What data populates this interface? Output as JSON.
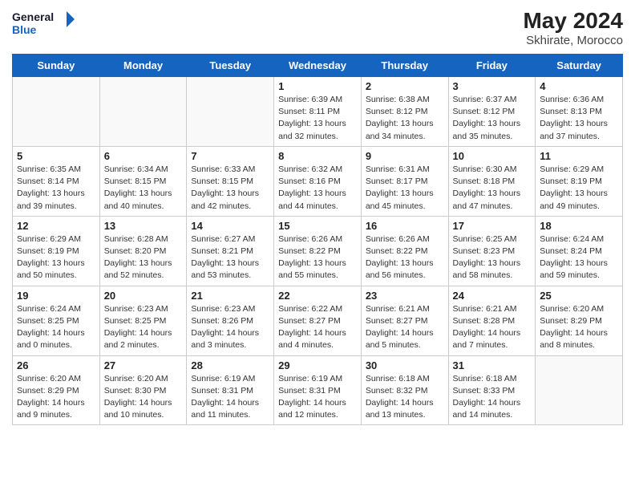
{
  "header": {
    "logo_line1": "General",
    "logo_line2": "Blue",
    "month_year": "May 2024",
    "location": "Skhirate, Morocco"
  },
  "days_of_week": [
    "Sunday",
    "Monday",
    "Tuesday",
    "Wednesday",
    "Thursday",
    "Friday",
    "Saturday"
  ],
  "weeks": [
    [
      {
        "num": "",
        "info": ""
      },
      {
        "num": "",
        "info": ""
      },
      {
        "num": "",
        "info": ""
      },
      {
        "num": "1",
        "info": "Sunrise: 6:39 AM\nSunset: 8:11 PM\nDaylight: 13 hours\nand 32 minutes."
      },
      {
        "num": "2",
        "info": "Sunrise: 6:38 AM\nSunset: 8:12 PM\nDaylight: 13 hours\nand 34 minutes."
      },
      {
        "num": "3",
        "info": "Sunrise: 6:37 AM\nSunset: 8:12 PM\nDaylight: 13 hours\nand 35 minutes."
      },
      {
        "num": "4",
        "info": "Sunrise: 6:36 AM\nSunset: 8:13 PM\nDaylight: 13 hours\nand 37 minutes."
      }
    ],
    [
      {
        "num": "5",
        "info": "Sunrise: 6:35 AM\nSunset: 8:14 PM\nDaylight: 13 hours\nand 39 minutes."
      },
      {
        "num": "6",
        "info": "Sunrise: 6:34 AM\nSunset: 8:15 PM\nDaylight: 13 hours\nand 40 minutes."
      },
      {
        "num": "7",
        "info": "Sunrise: 6:33 AM\nSunset: 8:15 PM\nDaylight: 13 hours\nand 42 minutes."
      },
      {
        "num": "8",
        "info": "Sunrise: 6:32 AM\nSunset: 8:16 PM\nDaylight: 13 hours\nand 44 minutes."
      },
      {
        "num": "9",
        "info": "Sunrise: 6:31 AM\nSunset: 8:17 PM\nDaylight: 13 hours\nand 45 minutes."
      },
      {
        "num": "10",
        "info": "Sunrise: 6:30 AM\nSunset: 8:18 PM\nDaylight: 13 hours\nand 47 minutes."
      },
      {
        "num": "11",
        "info": "Sunrise: 6:29 AM\nSunset: 8:19 PM\nDaylight: 13 hours\nand 49 minutes."
      }
    ],
    [
      {
        "num": "12",
        "info": "Sunrise: 6:29 AM\nSunset: 8:19 PM\nDaylight: 13 hours\nand 50 minutes."
      },
      {
        "num": "13",
        "info": "Sunrise: 6:28 AM\nSunset: 8:20 PM\nDaylight: 13 hours\nand 52 minutes."
      },
      {
        "num": "14",
        "info": "Sunrise: 6:27 AM\nSunset: 8:21 PM\nDaylight: 13 hours\nand 53 minutes."
      },
      {
        "num": "15",
        "info": "Sunrise: 6:26 AM\nSunset: 8:22 PM\nDaylight: 13 hours\nand 55 minutes."
      },
      {
        "num": "16",
        "info": "Sunrise: 6:26 AM\nSunset: 8:22 PM\nDaylight: 13 hours\nand 56 minutes."
      },
      {
        "num": "17",
        "info": "Sunrise: 6:25 AM\nSunset: 8:23 PM\nDaylight: 13 hours\nand 58 minutes."
      },
      {
        "num": "18",
        "info": "Sunrise: 6:24 AM\nSunset: 8:24 PM\nDaylight: 13 hours\nand 59 minutes."
      }
    ],
    [
      {
        "num": "19",
        "info": "Sunrise: 6:24 AM\nSunset: 8:25 PM\nDaylight: 14 hours\nand 0 minutes."
      },
      {
        "num": "20",
        "info": "Sunrise: 6:23 AM\nSunset: 8:25 PM\nDaylight: 14 hours\nand 2 minutes."
      },
      {
        "num": "21",
        "info": "Sunrise: 6:23 AM\nSunset: 8:26 PM\nDaylight: 14 hours\nand 3 minutes."
      },
      {
        "num": "22",
        "info": "Sunrise: 6:22 AM\nSunset: 8:27 PM\nDaylight: 14 hours\nand 4 minutes."
      },
      {
        "num": "23",
        "info": "Sunrise: 6:21 AM\nSunset: 8:27 PM\nDaylight: 14 hours\nand 5 minutes."
      },
      {
        "num": "24",
        "info": "Sunrise: 6:21 AM\nSunset: 8:28 PM\nDaylight: 14 hours\nand 7 minutes."
      },
      {
        "num": "25",
        "info": "Sunrise: 6:20 AM\nSunset: 8:29 PM\nDaylight: 14 hours\nand 8 minutes."
      }
    ],
    [
      {
        "num": "26",
        "info": "Sunrise: 6:20 AM\nSunset: 8:29 PM\nDaylight: 14 hours\nand 9 minutes."
      },
      {
        "num": "27",
        "info": "Sunrise: 6:20 AM\nSunset: 8:30 PM\nDaylight: 14 hours\nand 10 minutes."
      },
      {
        "num": "28",
        "info": "Sunrise: 6:19 AM\nSunset: 8:31 PM\nDaylight: 14 hours\nand 11 minutes."
      },
      {
        "num": "29",
        "info": "Sunrise: 6:19 AM\nSunset: 8:31 PM\nDaylight: 14 hours\nand 12 minutes."
      },
      {
        "num": "30",
        "info": "Sunrise: 6:18 AM\nSunset: 8:32 PM\nDaylight: 14 hours\nand 13 minutes."
      },
      {
        "num": "31",
        "info": "Sunrise: 6:18 AM\nSunset: 8:33 PM\nDaylight: 14 hours\nand 14 minutes."
      },
      {
        "num": "",
        "info": ""
      }
    ]
  ]
}
